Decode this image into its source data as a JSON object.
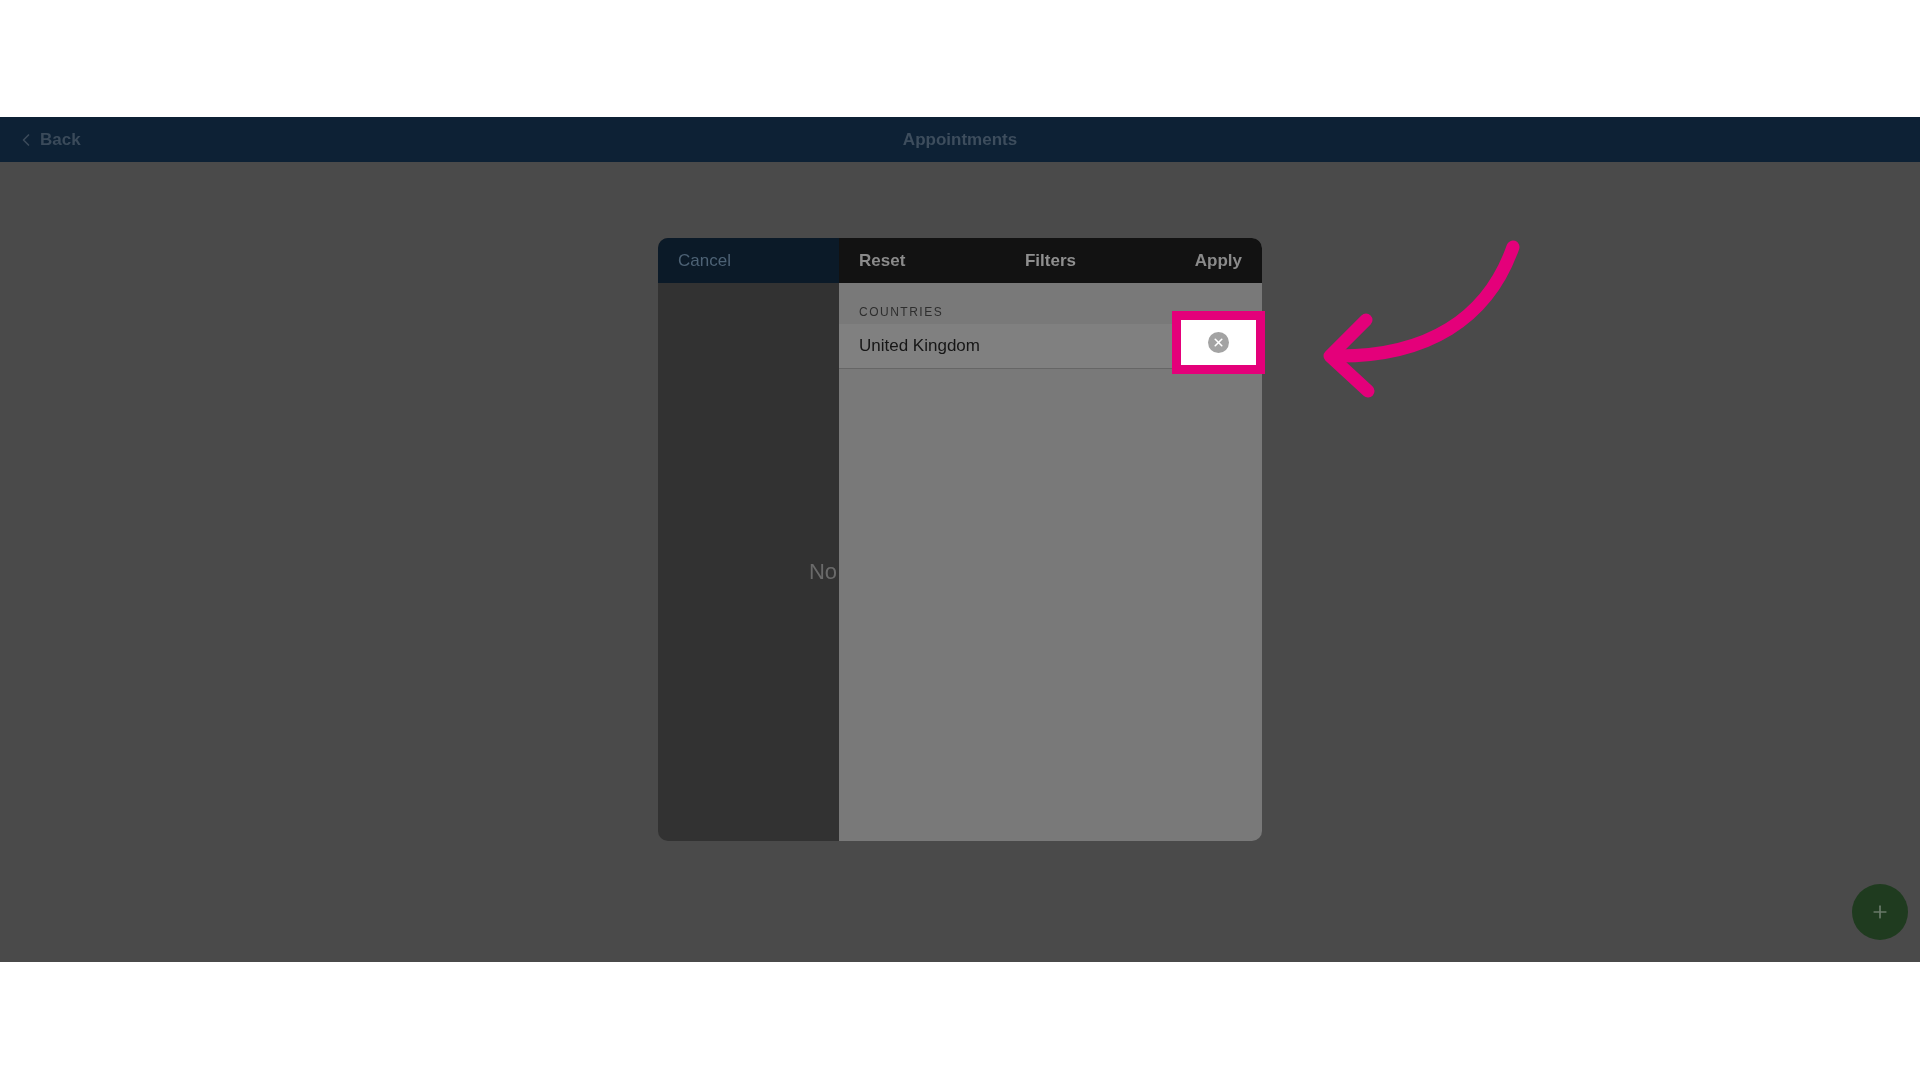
{
  "nav_bar": {
    "back": "Back",
    "title": "Appointments"
  },
  "background_text": "No",
  "filters_dialog": {
    "cancel": "Cancel",
    "reset": "Reset",
    "title": "Filters",
    "apply": "Apply",
    "section": "COUNTRIES",
    "rows": [
      {
        "label": "United Kingdom"
      }
    ]
  }
}
